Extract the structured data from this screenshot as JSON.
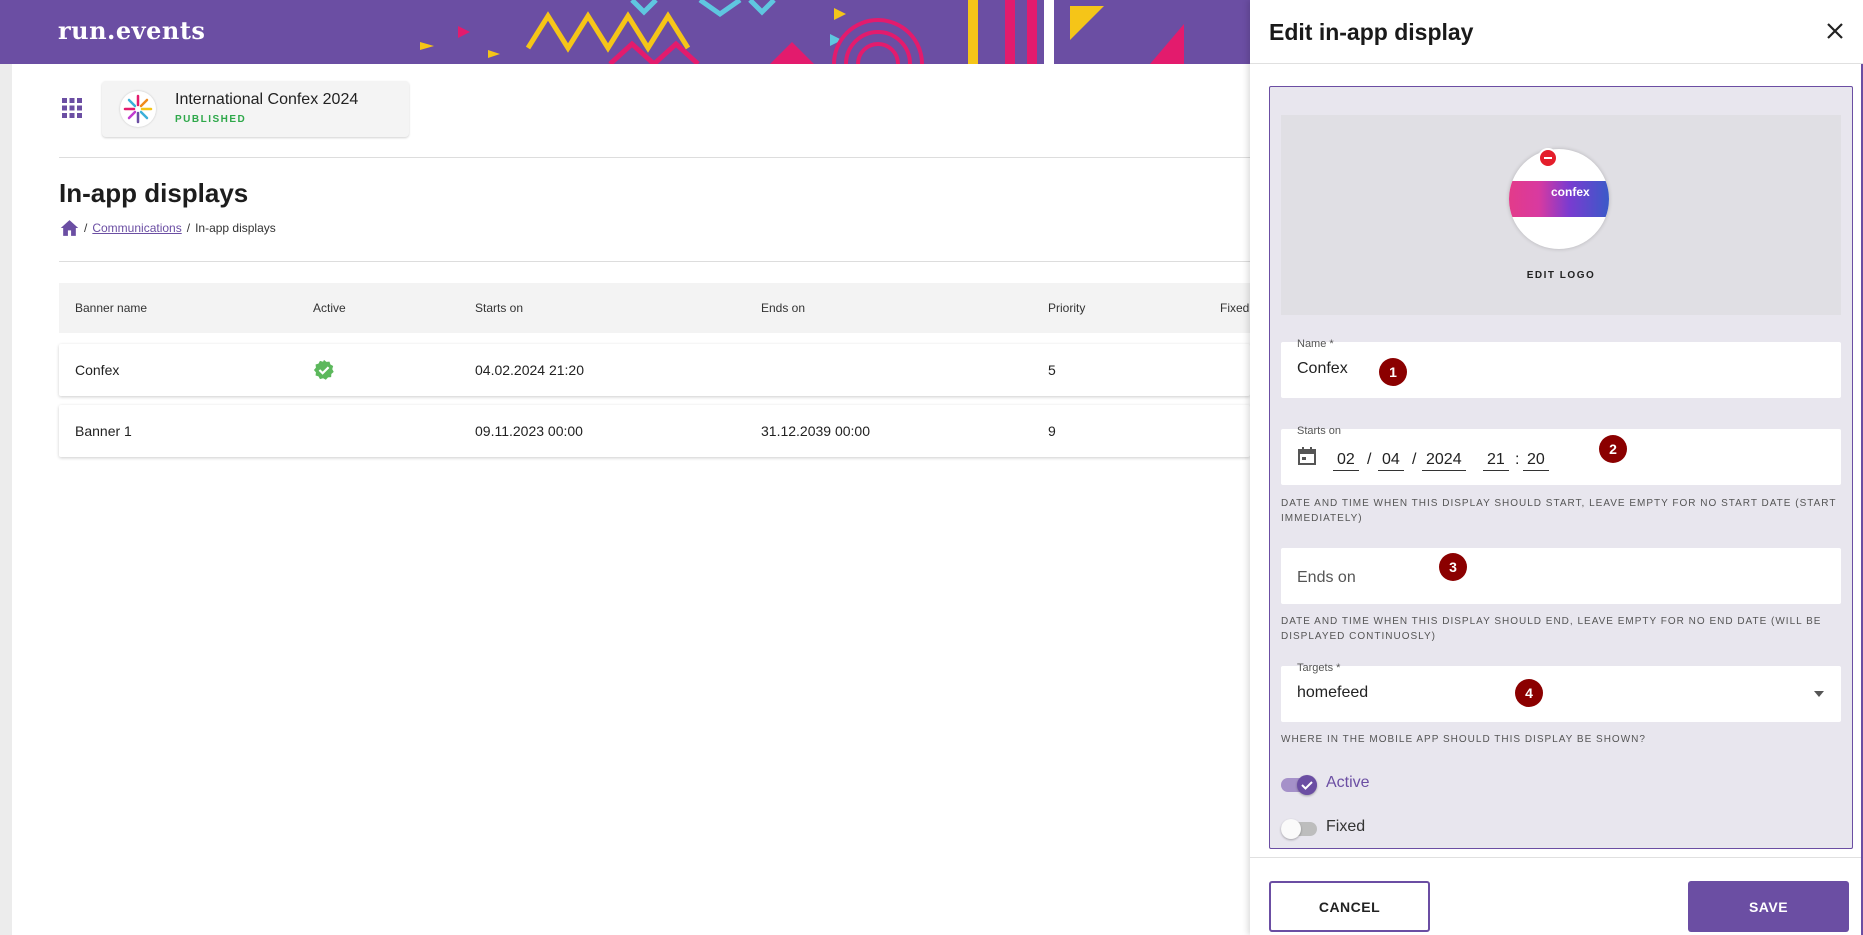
{
  "app": {
    "logo_text": "run.events"
  },
  "event": {
    "name": "International Confex 2024",
    "status": "PUBLISHED"
  },
  "page": {
    "title": "In-app displays",
    "breadcrumb": {
      "link": "Communications",
      "sep1": "/",
      "sep2": "/",
      "current": "In-app displays"
    }
  },
  "table": {
    "headers": [
      "Banner name",
      "Active",
      "Starts on",
      "Ends on",
      "Priority",
      "Fixed"
    ],
    "rows": [
      {
        "name": "Confex",
        "active": true,
        "starts": "04.02.2024 21:20",
        "ends": "",
        "priority": "5"
      },
      {
        "name": "Banner 1",
        "active": false,
        "starts": "09.11.2023 00:00",
        "ends": "31.12.2039 00:00",
        "priority": "9"
      }
    ]
  },
  "panel": {
    "title": "Edit in-app display",
    "logo_image_text": "confex",
    "edit_logo": "EDIT LOGO",
    "name_label": "Name *",
    "name_value": "Confex",
    "starts_label": "Starts on",
    "starts": {
      "day": "02",
      "month": "04",
      "year": "2024",
      "hour": "21",
      "minute": "20",
      "sep_date": "/",
      "sep_time": ":"
    },
    "starts_helper": "Date and time when this display should start, leave empty for no start date (start immediately)",
    "ends_placeholder": "Ends on",
    "ends_helper": "Date and time when this display should end, leave empty for no end date (will be displayed continuosly)",
    "targets_label": "Targets *",
    "targets_value": "homefeed",
    "targets_helper": "Where in the mobile app should this display be shown?",
    "active_label": "Active",
    "active_on": true,
    "fixed_label": "Fixed",
    "fixed_on": false,
    "cancel_label": "CANCEL",
    "save_label": "SAVE"
  },
  "markers": [
    "1",
    "2",
    "3",
    "4"
  ],
  "colors": {
    "brand": "#6b4ea3",
    "success": "#2ea84a",
    "marker": "#8b0000",
    "danger": "#e41e2b"
  }
}
